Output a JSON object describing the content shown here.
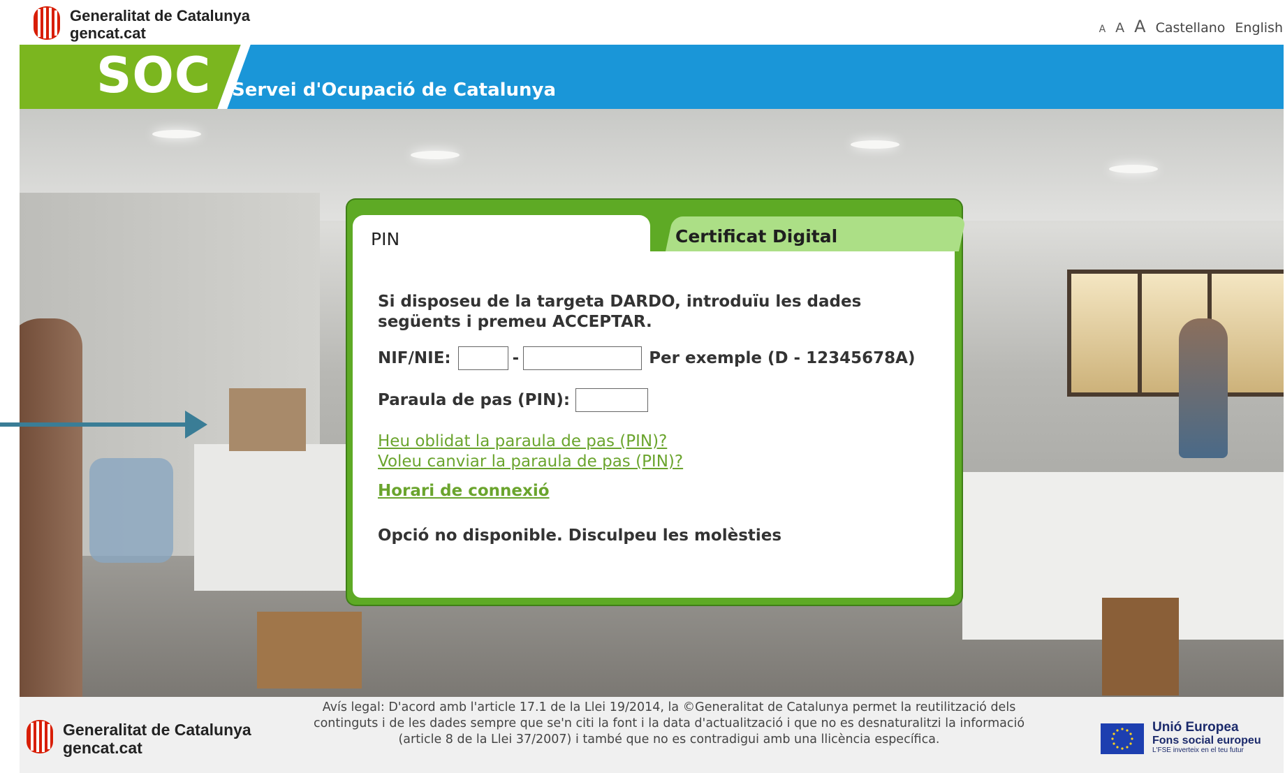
{
  "header": {
    "org_name": "Generalitat de Catalunya",
    "org_domain": "gencat.cat",
    "font_sizes": [
      "A",
      "A",
      "A"
    ],
    "languages": [
      "Castellano",
      "English"
    ]
  },
  "banner": {
    "title": "SOC",
    "subtitle": "Servei d'Ocupació de Catalunya"
  },
  "login": {
    "tabs": [
      {
        "label": "PIN",
        "active": true
      },
      {
        "label": "Certificat Digital",
        "active": false
      }
    ],
    "intro": "Si disposeu de la targeta DARDO, introduïu les dades següents i premeu ACCEPTAR.",
    "nif_label": "NIF/NIE:",
    "nif_separator": "-",
    "nif_example": "Per exemple (D - 12345678A)",
    "pin_label": "Paraula de pas (PIN):",
    "links": [
      "Heu oblidat la paraula de pas (PIN)?",
      "Voleu canviar la paraula de pas (PIN)?"
    ],
    "schedule_link": "Horari de connexió",
    "notice": "Opció no disponible. Disculpeu les molèsties"
  },
  "footer": {
    "org_name": "Generalitat de Catalunya",
    "org_domain": "gencat.cat",
    "legal": "Avís legal: D'acord amb l'article 17.1 de la Llei 19/2014, la ©Generalitat de Catalunya permet la reutilització dels continguts i de les dades sempre que se'n citi la font i la data d'actualització i que no es desnaturalitzi la informació (article 8 de la Llei 37/2007) i també que no es contradigui amb una llicència específica.",
    "eu_line1": "Unió Europea",
    "eu_line2": "Fons social europeu",
    "eu_line3": "L'FSE inverteix en el teu futur"
  },
  "colors": {
    "soc_green": "#7bb61f",
    "soc_blue": "#1a96d8",
    "panel_green": "#5eaa25",
    "link_green": "#6aa42d",
    "arrow": "#3a7d96"
  }
}
